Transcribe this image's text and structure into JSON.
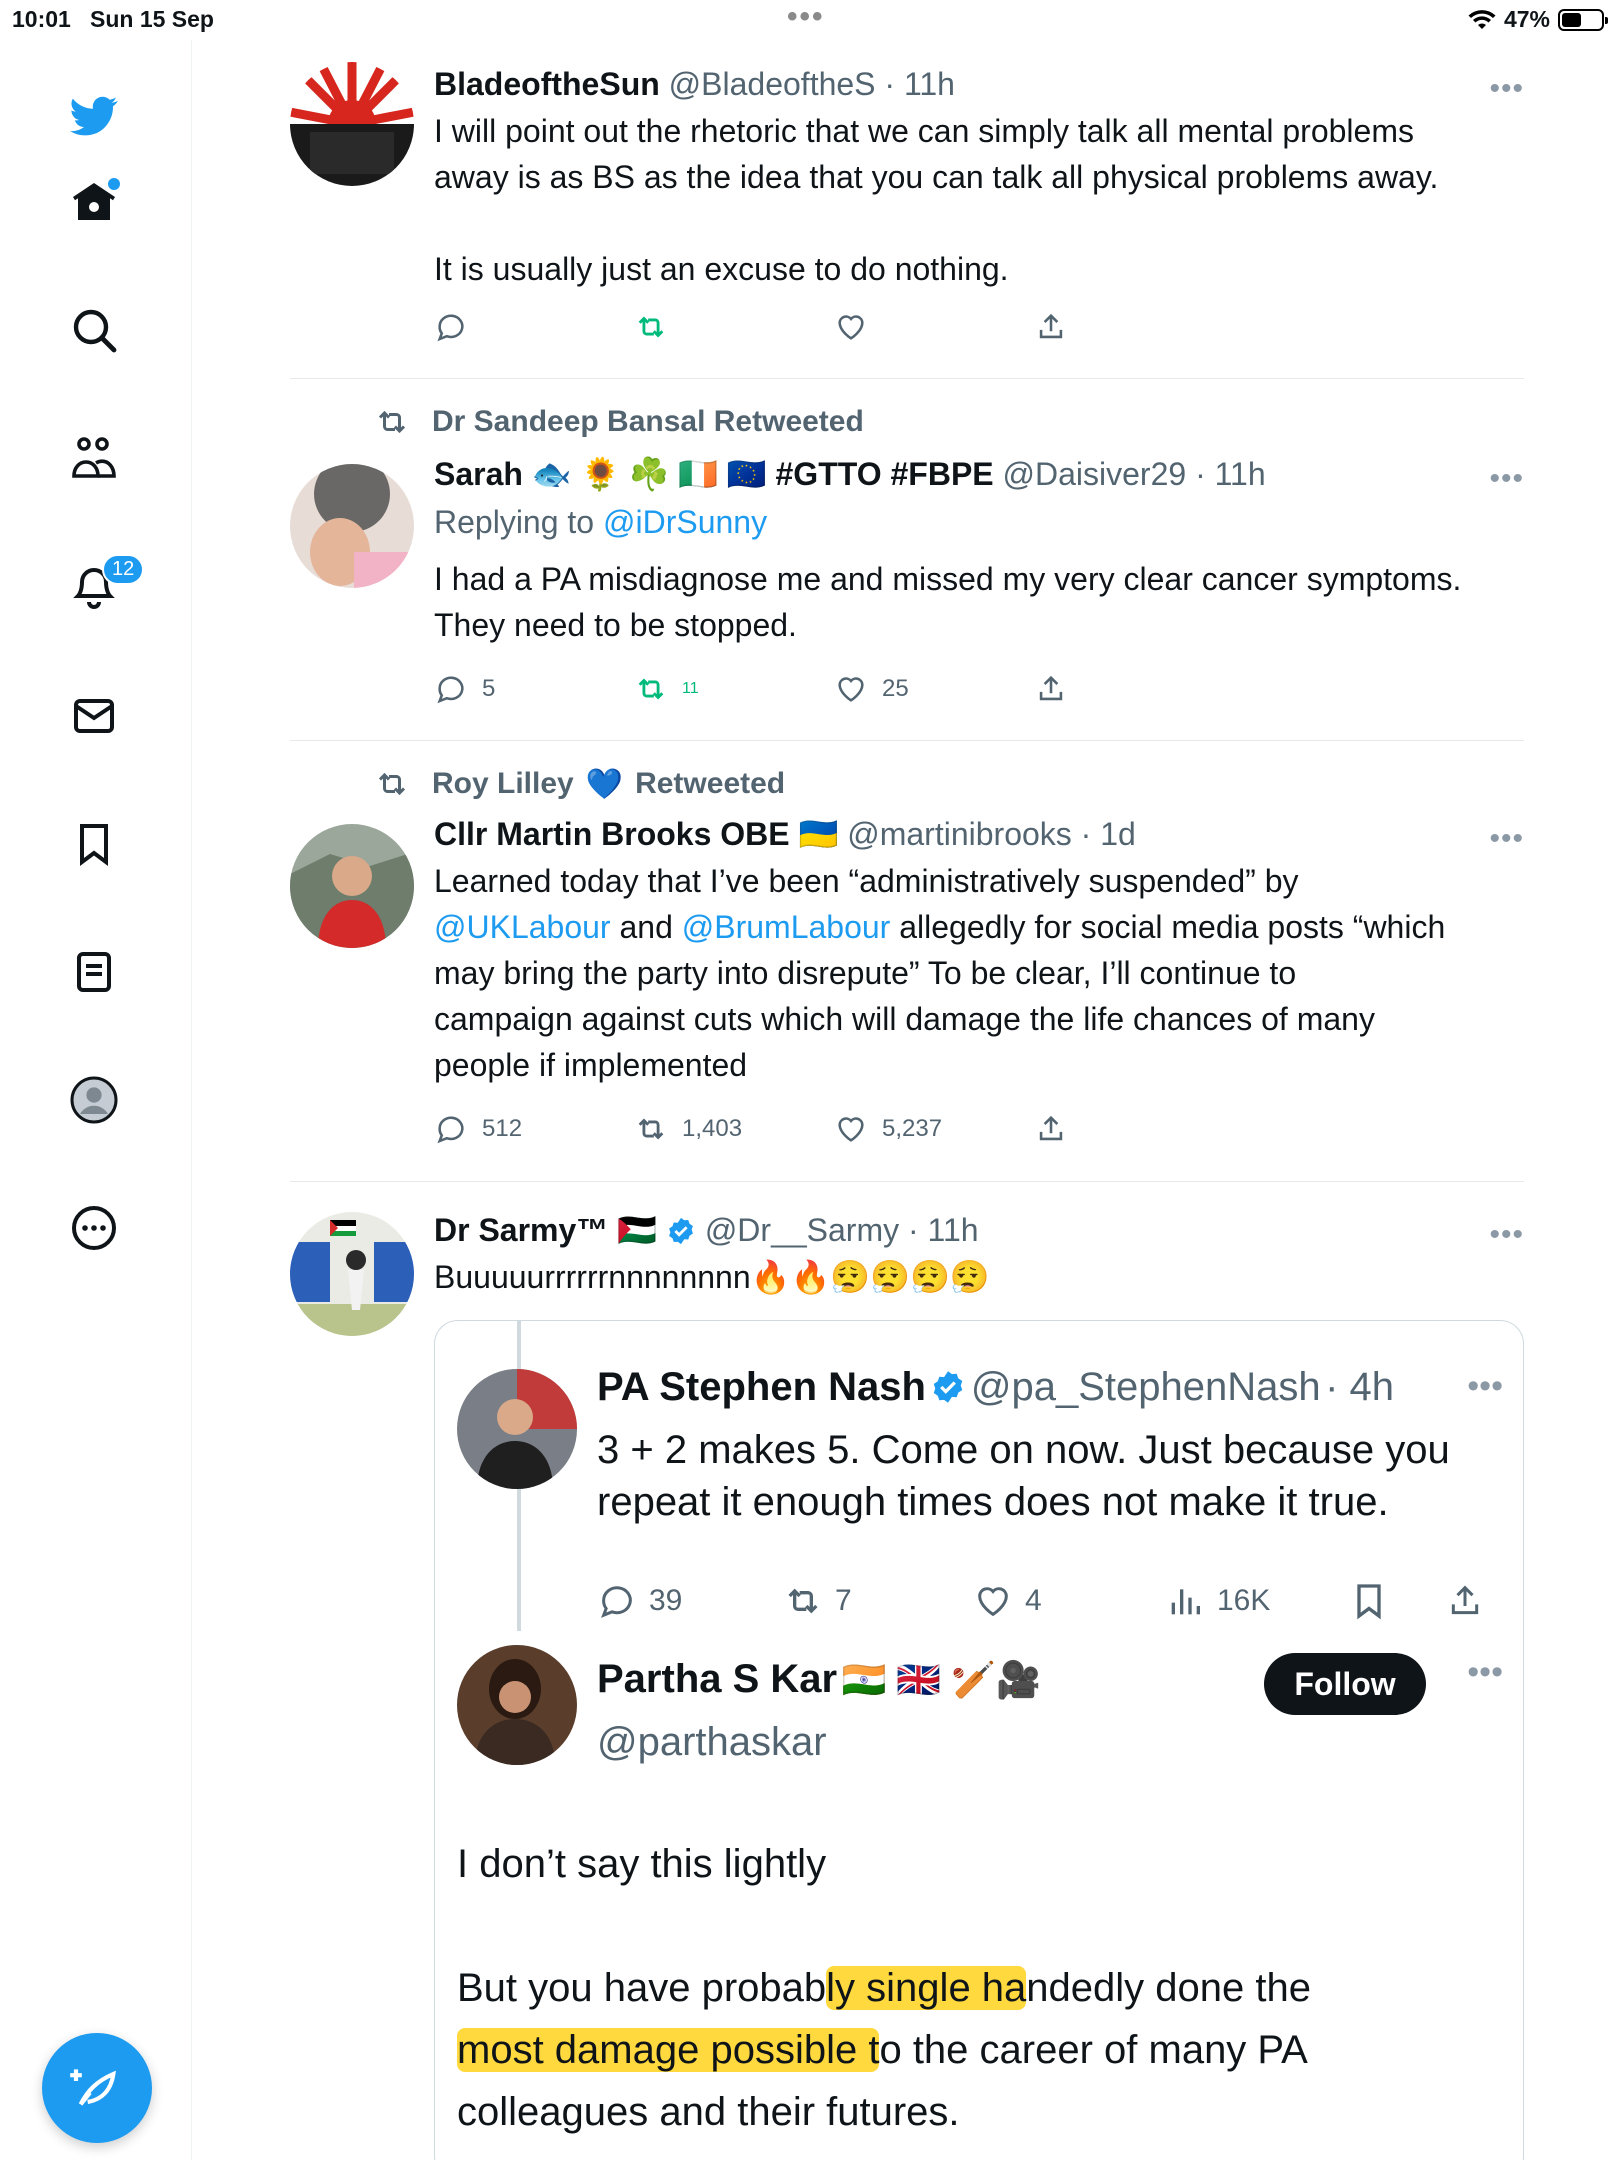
{
  "status_bar": {
    "time": "10:01",
    "date": "Sun 15 Sep",
    "dots": "•••",
    "battery": "47%"
  },
  "sidebar": {
    "notifications_badge": "12"
  },
  "tweets": [
    {
      "name": "BladeoftheSun",
      "handle": "@BladeoftheS",
      "time": "· 11h",
      "more": "•••",
      "text_lines": [
        "I will point out the rhetoric that we can simply talk all mental problems",
        "away is as BS as the idea that you can talk all physical problems away.",
        "",
        "It is usually just an excuse to do nothing."
      ],
      "counts": {
        "reply": "",
        "retweet": "",
        "like": ""
      }
    },
    {
      "retweeted_by": "Dr Sandeep Bansal Retweeted",
      "name": "Sarah",
      "name_emoji": "🐟  🌻 ☘️ 🇮🇪 🇪🇺",
      "name_tags": "#GTTO #FBPE",
      "handle": "@Daisiver29",
      "time": "· 11h",
      "more": "•••",
      "replying_to_prefix": "Replying to ",
      "replying_to": "@iDrSunny",
      "text_lines": [
        "I had a PA misdiagnose me and missed my very clear cancer symptoms.",
        "They need to be stopped."
      ],
      "counts": {
        "reply": "5",
        "retweet": "11",
        "like": "25"
      }
    },
    {
      "retweeted_by_name": "Roy Lilley",
      "retweeted_by_emoji": "💙",
      "retweeted_by_suffix": "Retweeted",
      "name": "Cllr Martin Brooks OBE",
      "name_emoji": "🇺🇦",
      "handle": "@martinibrooks",
      "time": "· 1d",
      "more": "•••",
      "text_1": "Learned today that I’ve been “administratively suspended” by",
      "link_1": "@UKLabour",
      "text_2": " and ",
      "link_2": "@BrumLabour",
      "text_3": " allegedly for social media posts “which",
      "text_4": "may bring the party into disrepute” To be clear, I’ll continue to",
      "text_5": "campaign against cuts which will damage the life chances of many",
      "text_6": "people if implemented",
      "counts": {
        "reply": "512",
        "retweet": "1,403",
        "like": "5,237"
      }
    },
    {
      "name": "Dr Sarmy™",
      "name_emoji": "🇵🇸",
      "handle": "@Dr__Sarmy",
      "time": "· 11h",
      "more": "•••",
      "text": "Buuuuurrrrrrnnnnnnnn",
      "text_emoji": "🔥🔥😮‍💨😮‍💨😮‍💨😮‍💨"
    }
  ],
  "quoted": {
    "first": {
      "name": "PA Stephen Nash",
      "handle": "@pa_StephenNash",
      "time": "· 4h",
      "more": "•••",
      "text_lines": [
        "3 + 2 makes 5. Come on now. Just because you",
        "repeat it enough times does not make it true."
      ],
      "counts": {
        "reply": "39",
        "retweet": "7",
        "like": "4",
        "views": "16K"
      }
    },
    "second": {
      "name": "Partha S Kar",
      "name_emoji": "🇮🇳 🇬🇧 🏏🎥",
      "handle": "@parthaskar",
      "follow_label": "Follow",
      "more": "•••",
      "line_1": "I don’t say this lightly",
      "line_2a": "But you have probab",
      "line_2b": "ly single ha",
      "line_2c": "ndedly done the",
      "line_3a": "most damage possible t",
      "line_3b": "o the career of many PA",
      "line_4": "colleagues and their futures."
    }
  }
}
